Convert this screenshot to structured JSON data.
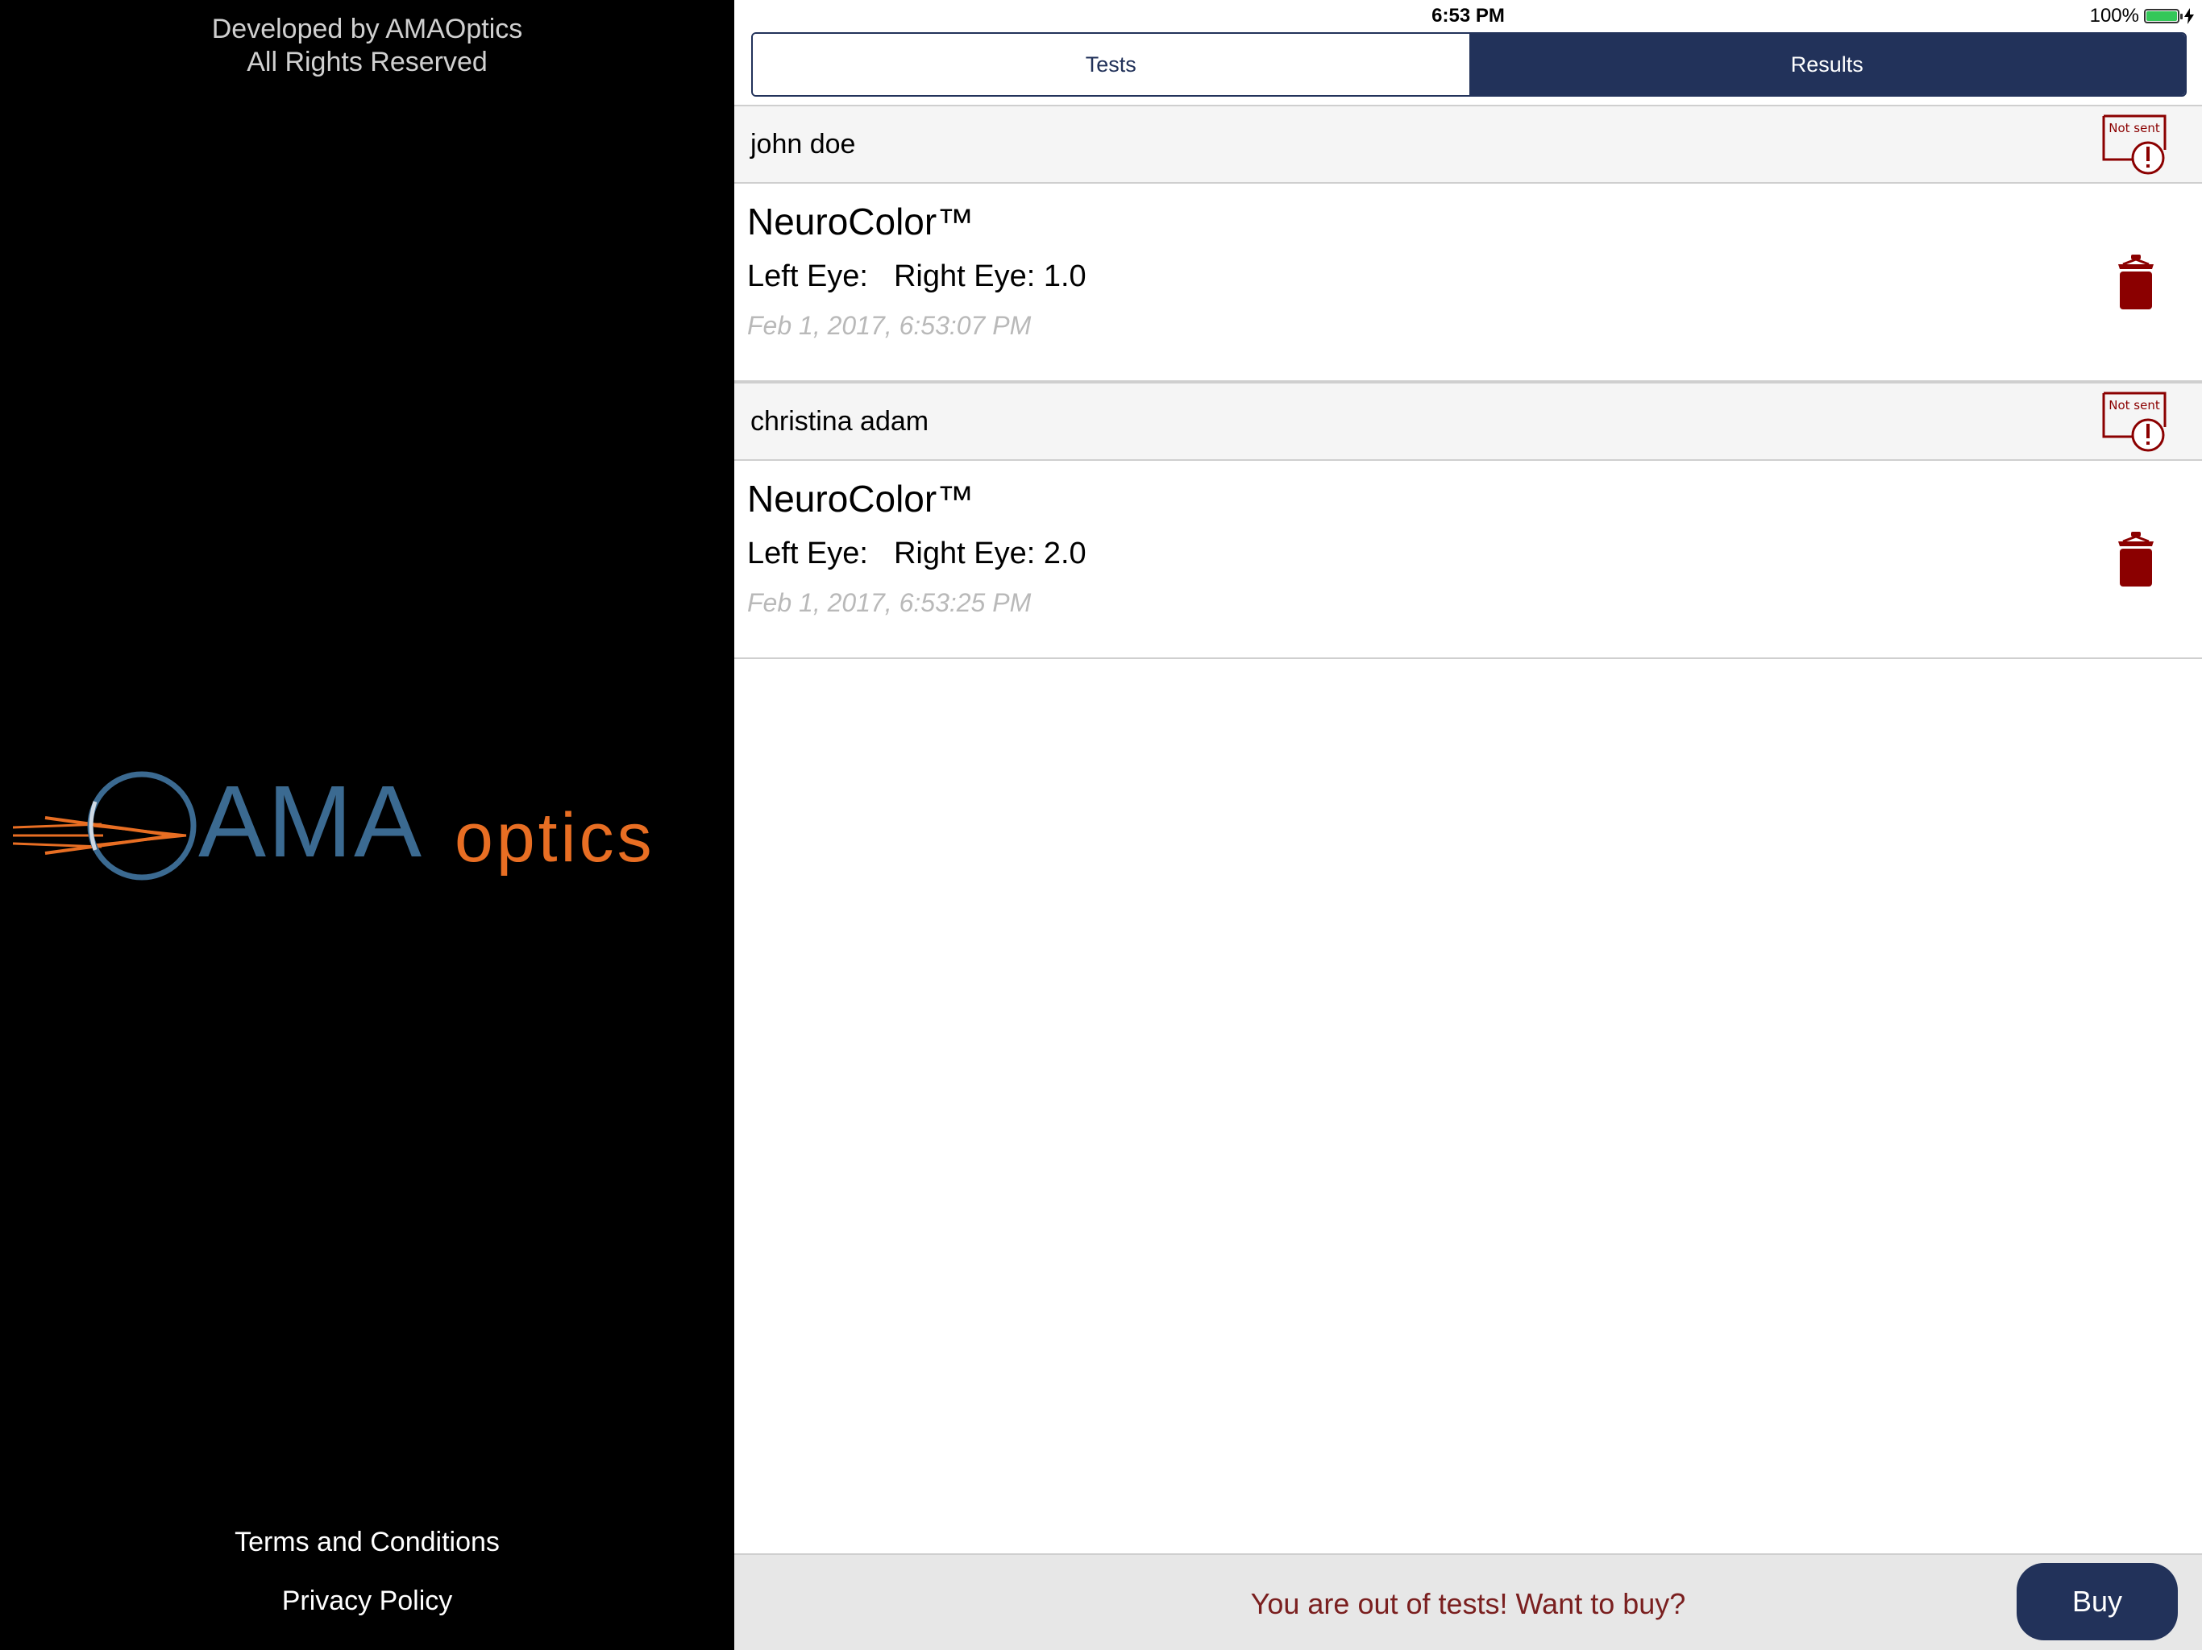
{
  "sidebar": {
    "credits_line1": "Developed by AMAOptics",
    "credits_line2": "All Rights Reserved",
    "logo_ama": "AMA",
    "logo_optics": "optics",
    "terms_label": "Terms and Conditions",
    "privacy_label": "Privacy Policy",
    "logo_blue": "#3b6a91",
    "logo_orange": "#e86e23"
  },
  "status_bar": {
    "time": "6:53 PM",
    "battery": "100%"
  },
  "tabs": [
    {
      "label": "Tests",
      "active": false
    },
    {
      "label": "Results",
      "active": true
    }
  ],
  "results": [
    {
      "patient": "john doe",
      "status_badge": "Not sent",
      "test_name": "NeuroColor™",
      "left_eye": "Left Eye:",
      "right_eye": "Right Eye: 1.0",
      "timestamp": "Feb 1, 2017, 6:53:07 PM"
    },
    {
      "patient": "christina adam",
      "status_badge": "Not sent",
      "test_name": "NeuroColor™",
      "left_eye": "Left Eye:",
      "right_eye": "Right Eye: 2.0",
      "timestamp": "Feb 1, 2017, 6:53:25 PM"
    }
  ],
  "footer": {
    "message": "You are out of tests! Want to buy?",
    "buy_label": "Buy"
  },
  "colors": {
    "navy": "#22325a",
    "alert_red": "#8b0000",
    "message_red": "#7a1f1f"
  }
}
